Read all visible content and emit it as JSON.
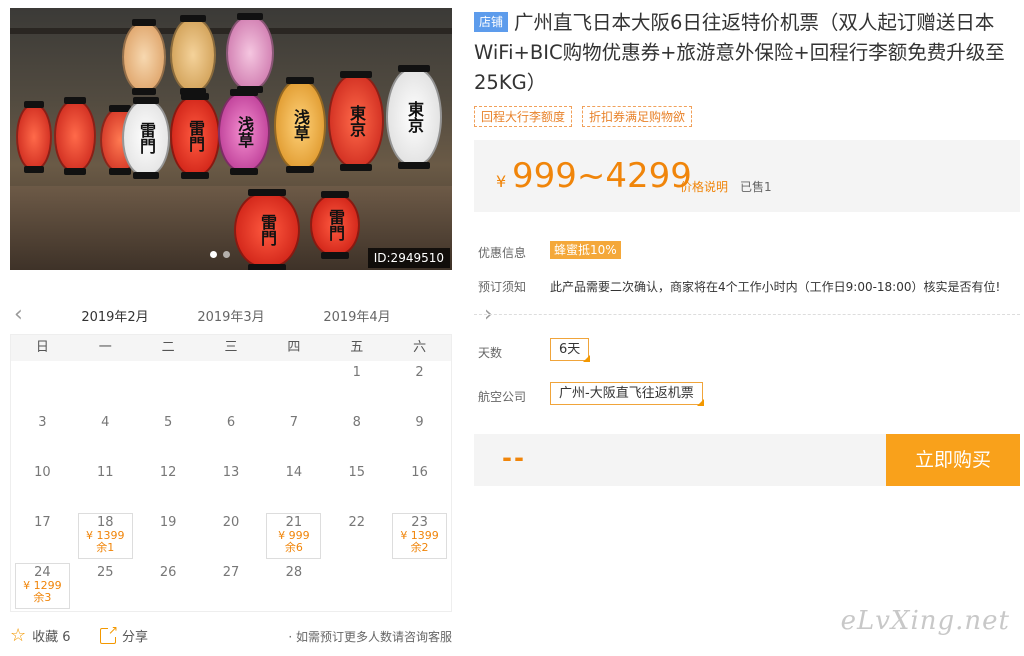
{
  "photo": {
    "id_label": "ID:2949510",
    "lantern_texts": [
      "雷門",
      "浅草",
      "東京",
      "東京",
      "雷門"
    ]
  },
  "calendar": {
    "months": [
      "2019年2月",
      "2019年3月",
      "2019年4月"
    ],
    "weekdays": [
      "日",
      "一",
      "二",
      "三",
      "四",
      "五",
      "六"
    ],
    "days": [
      {
        "d": ""
      },
      {
        "d": ""
      },
      {
        "d": ""
      },
      {
        "d": ""
      },
      {
        "d": ""
      },
      {
        "d": "1"
      },
      {
        "d": "2"
      },
      {
        "d": "3"
      },
      {
        "d": "4"
      },
      {
        "d": "5"
      },
      {
        "d": "6"
      },
      {
        "d": "7"
      },
      {
        "d": "8"
      },
      {
        "d": "9"
      },
      {
        "d": "10"
      },
      {
        "d": "11"
      },
      {
        "d": "12"
      },
      {
        "d": "13"
      },
      {
        "d": "14"
      },
      {
        "d": "15"
      },
      {
        "d": "16"
      },
      {
        "d": "17"
      },
      {
        "d": "18",
        "price": "¥ 1399",
        "stock": "余1"
      },
      {
        "d": "19"
      },
      {
        "d": "20"
      },
      {
        "d": "21",
        "price": "¥ 999",
        "stock": "余6"
      },
      {
        "d": "22"
      },
      {
        "d": "23",
        "price": "¥ 1399",
        "stock": "余2"
      },
      {
        "d": "24",
        "price": "¥ 1299",
        "stock": "余3"
      },
      {
        "d": "25"
      },
      {
        "d": "26"
      },
      {
        "d": "27"
      },
      {
        "d": "28"
      },
      {
        "d": ""
      },
      {
        "d": ""
      }
    ]
  },
  "actions": {
    "fav_label": "收藏 6",
    "share_label": "分享",
    "note": "· 如需预订更多人数请咨询客服"
  },
  "product": {
    "tag": "店铺",
    "title": "广州直飞日本大阪6日往返特价机票（双人起订赠送日本WiFi+BIC购物优惠券+旅游意外保险+回程行李额免费升级至25KG）",
    "badges": [
      "回程大行李额度",
      "折扣券满足购物欲"
    ]
  },
  "price": {
    "currency": "¥",
    "range": "999~4299",
    "explain": "价格说明",
    "sold": "已售1"
  },
  "info": {
    "promo_label": "优惠信息",
    "promo_value": "蜂蜜抵10%",
    "notice_label": "预订须知",
    "notice_value": "此产品需要二次确认，商家将在4个工作小时内（工作日9:00-18:00）核实是否有位!"
  },
  "options": {
    "days_label": "天数",
    "days_value": "6天",
    "airline_label": "航空公司",
    "airline_value": "广州-大阪直飞往返机票"
  },
  "buy": {
    "total": "--",
    "button": "立即购买"
  },
  "watermark": "eLvXing.net",
  "colors": {
    "accent": "#f39800",
    "price": "#f0850a",
    "tag": "#5d9cec",
    "buy": "#f9a11b"
  }
}
